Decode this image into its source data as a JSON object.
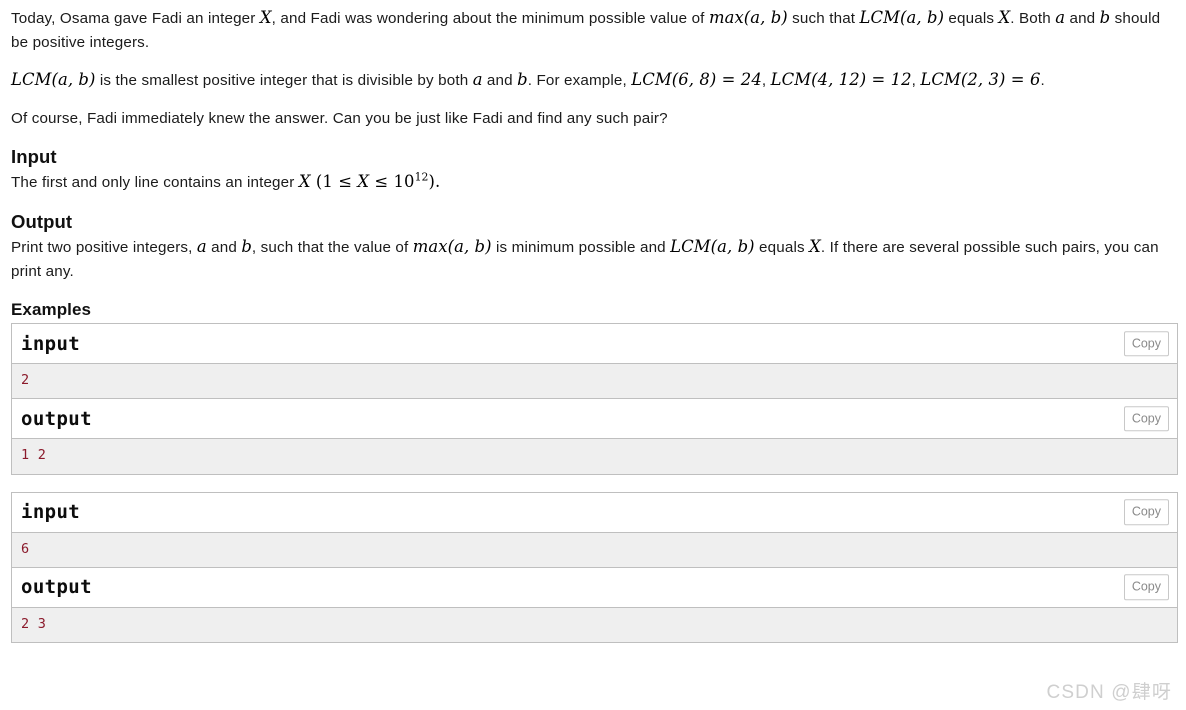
{
  "statement": {
    "p1": {
      "t1": "Today, Osama gave Fadi an integer ",
      "m1": "X",
      "t2": ", and Fadi was wondering about the minimum possible value of ",
      "m2": "max(a, b)",
      "t3": " such that ",
      "m3": "LCM(a, b)",
      "t4": " equals ",
      "m4": "X",
      "t5": ". Both ",
      "m5": "a",
      "t6": " and ",
      "m6": "b",
      "t7": " should be positive integers."
    },
    "p2": {
      "m1": "LCM(a, b)",
      "t1": " is the smallest positive integer that is divisible by both ",
      "m2": "a",
      "t2": " and ",
      "m3": "b",
      "t3": ". For example, ",
      "m4": "LCM(6, 8) = 24",
      "t4": ", ",
      "m5": "LCM(4, 12) = 12",
      "t5": ", ",
      "m6": "LCM(2, 3) = 6",
      "t6": "."
    },
    "p3": "Of course, Fadi immediately knew the answer. Can you be just like Fadi and find any such pair?"
  },
  "input_section": {
    "heading": "Input",
    "text_before": "The first and only line contains an integer ",
    "var": "X",
    "constraint_open": " (1 ≤ ",
    "constraint_var": "X",
    "constraint_mid": " ≤ 10",
    "constraint_exp": "12",
    "constraint_close": ").",
    "text_after": ""
  },
  "output_section": {
    "heading": "Output",
    "t1": "Print two positive integers, ",
    "m1": "a",
    "t2": " and ",
    "m2": "b",
    "t3": ", such that the value of ",
    "m3": "max(a, b)",
    "t4": " is minimum possible and ",
    "m4": "LCM(a, b)",
    "t5": " equals ",
    "m5": "X",
    "t6": ". If there are several possible such pairs, you can print any."
  },
  "examples": {
    "heading": "Examples",
    "copy_label": "Copy",
    "input_label": "input",
    "output_label": "output",
    "tests": [
      {
        "input": "2",
        "output": "1 2"
      },
      {
        "input": "6",
        "output": "2 3"
      }
    ]
  },
  "watermark": "CSDN @肆呀",
  "colors": {
    "text": "#1b1b1b",
    "sample_data": "#8b1a2b",
    "sample_bg": "#efefef",
    "border": "#bfbfbf",
    "copy_text": "#8a8a8a",
    "watermark": "#cfcfcf"
  }
}
